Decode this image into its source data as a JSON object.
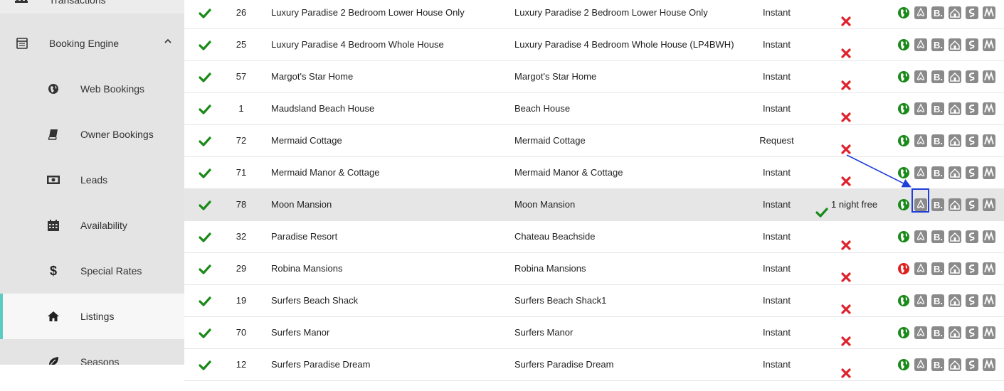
{
  "sidebar": {
    "top_item": {
      "label": "Transactions",
      "icon": "bank-icon"
    },
    "section": {
      "label": "Booking Engine",
      "icon": "calendar-list-icon",
      "chevron": "chevron-up-icon"
    },
    "items": [
      {
        "label": "Web Bookings",
        "icon": "globe-icon"
      },
      {
        "label": "Owner Bookings",
        "icon": "book-icon"
      },
      {
        "label": "Leads",
        "icon": "money-icon"
      },
      {
        "label": "Availability",
        "icon": "calendar-icon"
      },
      {
        "label": "Special Rates",
        "icon": "dollar-icon"
      },
      {
        "label": "Listings",
        "icon": "home-icon",
        "active": true
      },
      {
        "label": "Seasons",
        "icon": "leaf-icon"
      }
    ]
  },
  "colors": {
    "check_green": "#1a8a1a",
    "x_red": "#e0202a",
    "globe_green": "#1a8a1a",
    "globe_red": "#e02020",
    "channel_grey": "#8a8a8a",
    "active_accent": "#5ecbc1",
    "annotation_blue": "#1f3fd8"
  },
  "rows": [
    {
      "id": "26",
      "name": "Luxury Paradise 2 Bedroom Lower House Only",
      "title": "Luxury Paradise 2 Bedroom Lower House Only",
      "booking": "Instant",
      "promo": "",
      "globe": "green"
    },
    {
      "id": "25",
      "name": "Luxury Paradise 4 Bedroom Whole House",
      "title": "Luxury Paradise 4 Bedroom Whole House (LP4BWH)",
      "booking": "Instant",
      "promo": "",
      "globe": "green"
    },
    {
      "id": "57",
      "name": "Margot's Star Home",
      "title": "Margot's Star Home",
      "booking": "Instant",
      "promo": "",
      "globe": "green"
    },
    {
      "id": "1",
      "name": "Maudsland Beach House",
      "title": "Beach House",
      "booking": "Instant",
      "promo": "",
      "globe": "green"
    },
    {
      "id": "72",
      "name": "Mermaid Cottage",
      "title": "Mermaid Cottage",
      "booking": "Request",
      "promo": "",
      "globe": "green"
    },
    {
      "id": "71",
      "name": "Mermaid Manor & Cottage",
      "title": "Mermaid Manor & Cottage",
      "booking": "Instant",
      "promo": "",
      "globe": "green"
    },
    {
      "id": "78",
      "name": "Moon Mansion",
      "title": "Moon Mansion",
      "booking": "Instant",
      "promo": "1 night free",
      "globe": "green",
      "highlight": true
    },
    {
      "id": "32",
      "name": "Paradise Resort",
      "title": "Chateau Beachside",
      "booking": "Instant",
      "promo": "",
      "globe": "green"
    },
    {
      "id": "29",
      "name": "Robina Mansions",
      "title": "Robina Mansions",
      "booking": "Instant",
      "promo": "",
      "globe": "red"
    },
    {
      "id": "19",
      "name": "Surfers Beach Shack",
      "title": "Surfers Beach Shack1",
      "booking": "Instant",
      "promo": "",
      "globe": "green"
    },
    {
      "id": "70",
      "name": "Surfers Manor",
      "title": "Surfers Manor",
      "booking": "Instant",
      "promo": "",
      "globe": "green"
    },
    {
      "id": "12",
      "name": "Surfers Paradise Dream",
      "title": "Surfers Paradise Dream",
      "booking": "Instant",
      "promo": "",
      "globe": "green"
    }
  ],
  "channels": [
    {
      "name": "website-globe-icon",
      "glyph": ""
    },
    {
      "name": "airbnb-icon",
      "glyph": ""
    },
    {
      "name": "booking-com-icon",
      "glyph": "B."
    },
    {
      "name": "homeaway-icon",
      "glyph": ""
    },
    {
      "name": "stayz-icon",
      "glyph": "S"
    },
    {
      "name": "tripadvisor-icon",
      "glyph": "M"
    }
  ]
}
